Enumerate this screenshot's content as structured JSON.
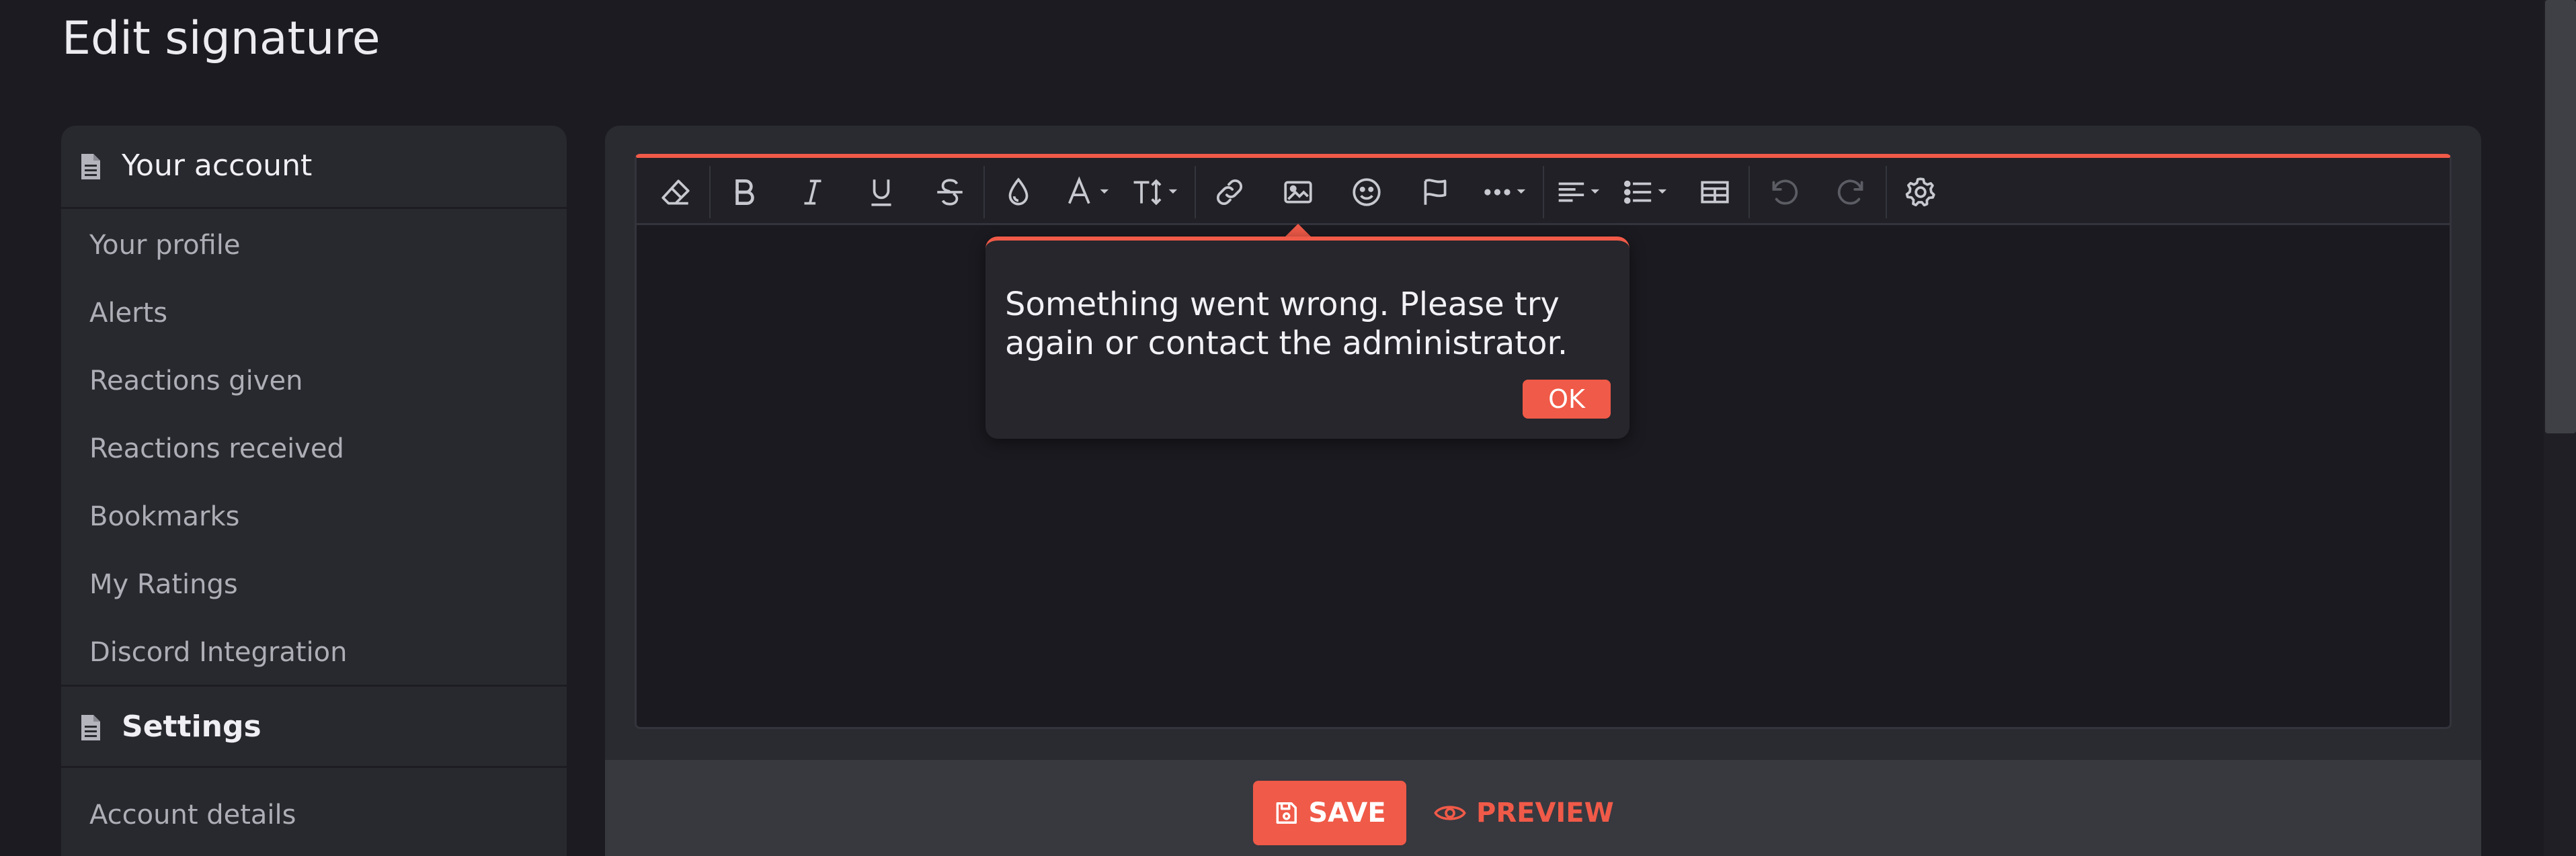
{
  "page": {
    "title": "Edit signature"
  },
  "sidebar": {
    "sections": [
      {
        "header": "Your account",
        "items": [
          "Your profile",
          "Alerts",
          "Reactions given",
          "Reactions received",
          "Bookmarks",
          "My Ratings",
          "Discord Integration"
        ]
      },
      {
        "header": "Settings",
        "items": [
          "Account details"
        ]
      }
    ]
  },
  "toolbar": {
    "buttons": [
      {
        "name": "clear-formatting-icon",
        "enabled": true
      },
      {
        "name": "bold-icon",
        "enabled": true
      },
      {
        "name": "italic-icon",
        "enabled": true
      },
      {
        "name": "underline-icon",
        "enabled": true
      },
      {
        "name": "strikethrough-icon",
        "enabled": true
      },
      {
        "name": "text-color-icon",
        "enabled": true
      },
      {
        "name": "font-family-icon",
        "enabled": true
      },
      {
        "name": "font-size-icon",
        "enabled": true
      },
      {
        "name": "link-icon",
        "enabled": true
      },
      {
        "name": "image-icon",
        "enabled": true
      },
      {
        "name": "smiley-icon",
        "enabled": true
      },
      {
        "name": "flag-icon",
        "enabled": true
      },
      {
        "name": "more-options-icon",
        "enabled": true
      },
      {
        "name": "align-icon",
        "enabled": true
      },
      {
        "name": "list-icon",
        "enabled": true
      },
      {
        "name": "table-icon",
        "enabled": true
      },
      {
        "name": "undo-icon",
        "enabled": false
      },
      {
        "name": "redo-icon",
        "enabled": false
      },
      {
        "name": "settings-gear-icon",
        "enabled": true
      }
    ]
  },
  "popup": {
    "message": "Something went wrong. Please try again or contact the administrator.",
    "ok_label": "OK"
  },
  "footer": {
    "save_label": "SAVE",
    "preview_label": "PREVIEW"
  },
  "colors": {
    "accent": "#f05a48",
    "background": "#1b1b21",
    "panel": "#28282f"
  }
}
